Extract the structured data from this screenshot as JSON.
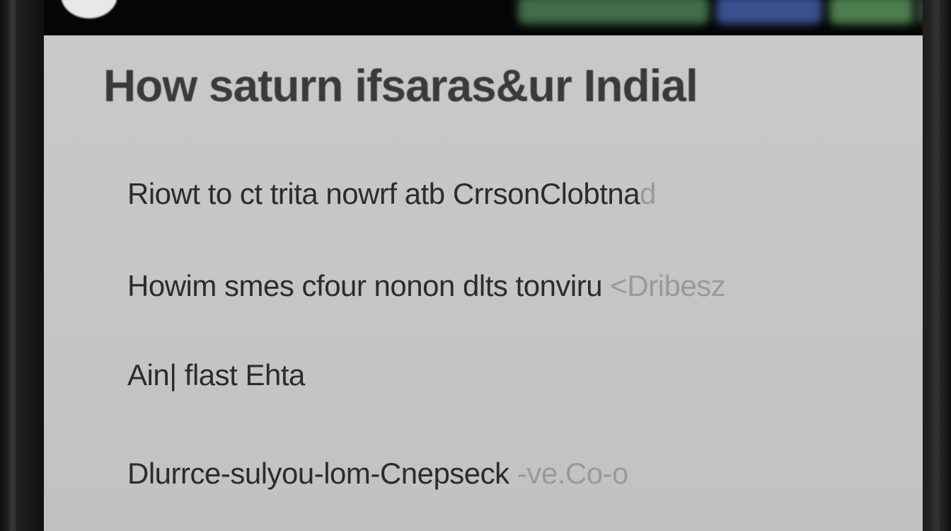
{
  "header": {
    "title": "How saturn ifsaras&ur Indial"
  },
  "content": {
    "lines": [
      {
        "text": "Riowt to ct trita nowrf atb CrrsonClobtna",
        "faded_tail": "d"
      },
      {
        "text": "Howim smes cfour nonon dlts tonviru",
        "faded_tail": "<Dribesz"
      },
      {
        "text": "Ain| flast Ehta",
        "faded_tail": ""
      },
      {
        "text": "Dlurrce-sulyou-lom-Cnepseck",
        "faded_tail": "-ve.Co-o"
      }
    ]
  },
  "colors": {
    "screen_bg": "#c8c8c8",
    "bezel": "#111111",
    "text": "#2c2c2c",
    "accent_green": "#3f6e47",
    "accent_blue": "#3a4f8e"
  }
}
